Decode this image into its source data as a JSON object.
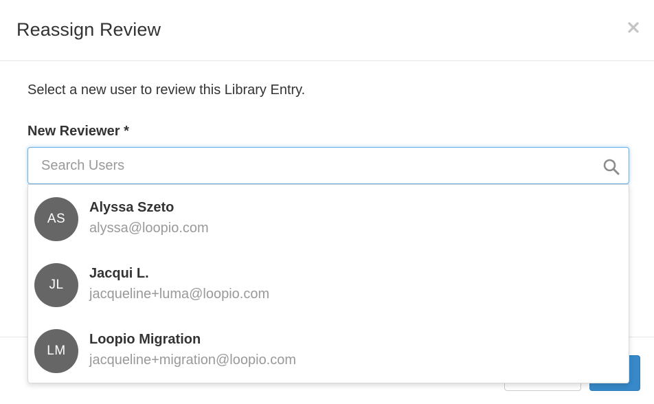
{
  "modal": {
    "title": "Reassign Review",
    "close_symbol": "×",
    "close_icon": "close-icon"
  },
  "body": {
    "intro": "Select a new user to review this Library Entry.",
    "field_label": "New Reviewer *",
    "search": {
      "value": "",
      "placeholder": "Search Users",
      "icon": "search-icon"
    }
  },
  "dropdown": {
    "options": [
      {
        "initials": "AS",
        "name": "Alyssa Szeto",
        "email": "alyssa@loopio.com"
      },
      {
        "initials": "JL",
        "name": "Jacqui L.",
        "email": "jacqueline+luma@loopio.com"
      },
      {
        "initials": "LM",
        "name": "Loopio Migration",
        "email": "jacqueline+migration@loopio.com"
      }
    ]
  },
  "colors": {
    "avatar_bg": "#666666",
    "focus_border": "#66afe9",
    "primary_button": "#3789c9",
    "muted_text": "#999999",
    "text": "#333333"
  }
}
